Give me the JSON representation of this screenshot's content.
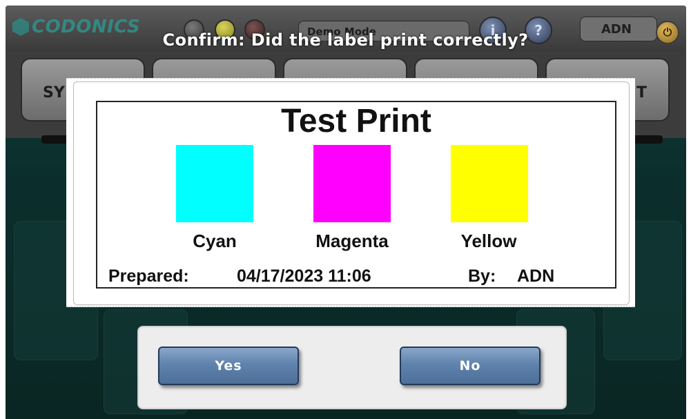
{
  "app": {
    "brand": "CODONICS",
    "mode": "Demo Mode",
    "info_glyph": "i",
    "help_glyph": "?",
    "user": "ADN",
    "power_glyph": "⏻",
    "nav_tabs": [
      "SY",
      "",
      "",
      "",
      "T"
    ]
  },
  "dialog": {
    "title": "Confirm: Did the label print correctly?",
    "label": {
      "title": "Test Print",
      "swatches": [
        {
          "name": "Cyan",
          "color": "#00ffff"
        },
        {
          "name": "Magenta",
          "color": "#ff00ff"
        },
        {
          "name": "Yellow",
          "color": "#ffff00"
        }
      ],
      "prepared_label": "Prepared:",
      "prepared_value": "04/17/2023 11:06",
      "by_label": "By:",
      "by_value": "ADN"
    },
    "yes_label": "Yes",
    "no_label": "No"
  }
}
